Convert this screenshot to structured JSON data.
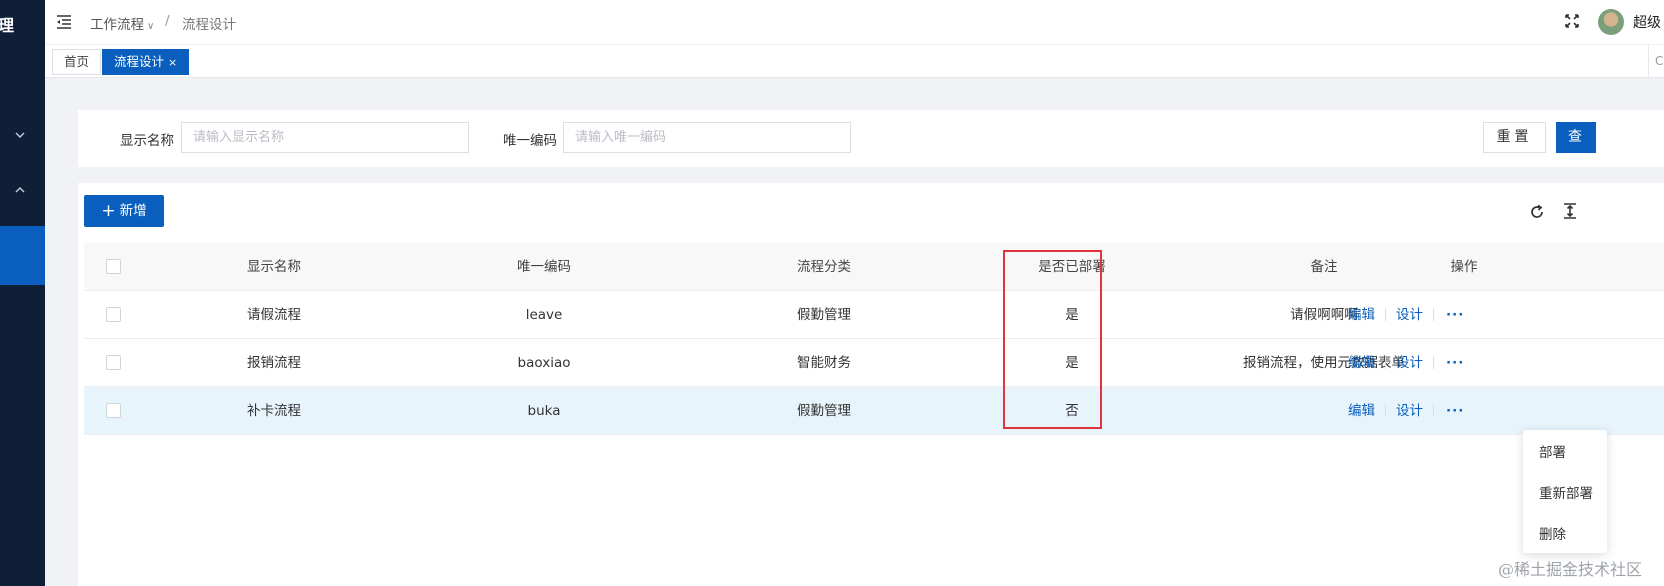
{
  "sidebar": {
    "title_fragment": "理"
  },
  "breadcrumb": {
    "level1": "工作流程",
    "separator": "/",
    "level2": "流程设计"
  },
  "header": {
    "username": "超级"
  },
  "tabs": [
    {
      "label": "首页"
    },
    {
      "label": "流程设计",
      "close": "×"
    }
  ],
  "tabs_bar_right": "C",
  "search": {
    "name_label": "显示名称",
    "name_placeholder": "请输入显示名称",
    "code_label": "唯一编码",
    "code_placeholder": "请输入唯一编码",
    "reset_label": "重置",
    "query_label": "查"
  },
  "toolbar": {
    "add_label": "新增"
  },
  "table": {
    "columns": {
      "name": "显示名称",
      "code": "唯一编码",
      "category": "流程分类",
      "deployed": "是否已部署",
      "remark": "备注",
      "ops": "操作"
    },
    "rows": [
      {
        "name": "请假流程",
        "code": "leave",
        "category": "假勤管理",
        "deployed": "是",
        "remark": "请假啊啊啊"
      },
      {
        "name": "报销流程",
        "code": "baoxiao",
        "category": "智能财务",
        "deployed": "是",
        "remark": "报销流程，使用元数据表单"
      },
      {
        "name": "补卡流程",
        "code": "buka",
        "category": "假勤管理",
        "deployed": "否",
        "remark": ""
      }
    ],
    "op_edit": "编辑",
    "op_design": "设计",
    "op_more": "···"
  },
  "dropdown": {
    "items": [
      "部署",
      "重新部署",
      "删除"
    ]
  },
  "watermark": "@稀土掘金技术社区",
  "colors": {
    "sidebar_bg": "#0f1f38",
    "primary": "#0a5ebd",
    "highlight_row": "#e8f4fc",
    "annotation_red": "#e0353a"
  }
}
